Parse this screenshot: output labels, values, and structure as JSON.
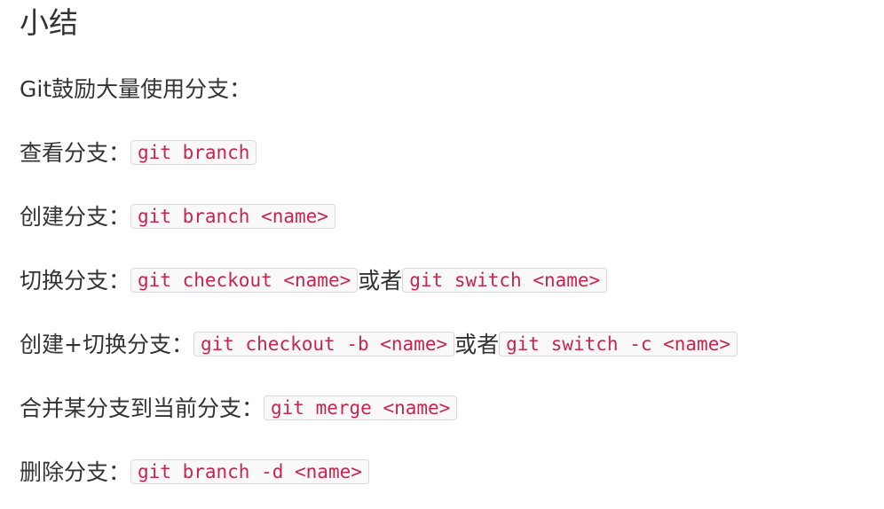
{
  "heading": "小结",
  "intro": "Git鼓励大量使用分支：",
  "items": [
    {
      "label": "查看分支：",
      "code1": "git branch"
    },
    {
      "label": "创建分支：",
      "code1": "git branch <name>"
    },
    {
      "label": "切换分支：",
      "code1": "git checkout <name>",
      "connector": "或者",
      "code2": "git switch <name>"
    },
    {
      "label": "创建+切换分支：",
      "code1": "git checkout -b <name>",
      "connector": "或者",
      "code2": "git switch -c <name>"
    },
    {
      "label": "合并某分支到当前分支：",
      "code1": "git merge <name>"
    },
    {
      "label": "删除分支：",
      "code1": "git branch -d <name>"
    }
  ]
}
